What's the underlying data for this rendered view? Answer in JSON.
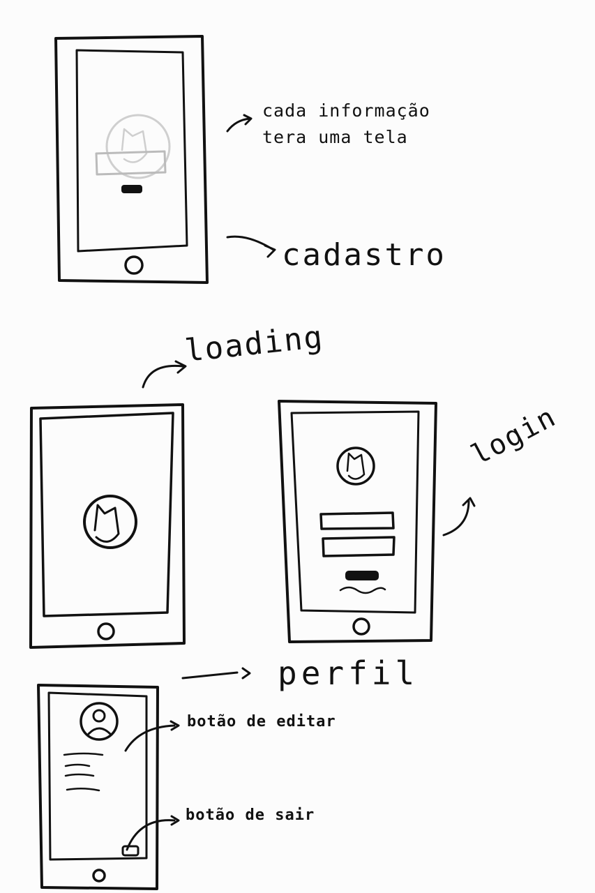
{
  "annotations": {
    "cadastro_note_line1": "cada informação",
    "cadastro_note_line2": "tera uma tela",
    "cadastro": "cadastro",
    "loading": "loading",
    "login": "login",
    "perfil": "perfil",
    "edit_button": "botão de editar",
    "exit_button": "botão de sair"
  },
  "colors": {
    "ink": "#111111",
    "faded": "#cfcfcf",
    "paper": "#fcfcfc"
  }
}
